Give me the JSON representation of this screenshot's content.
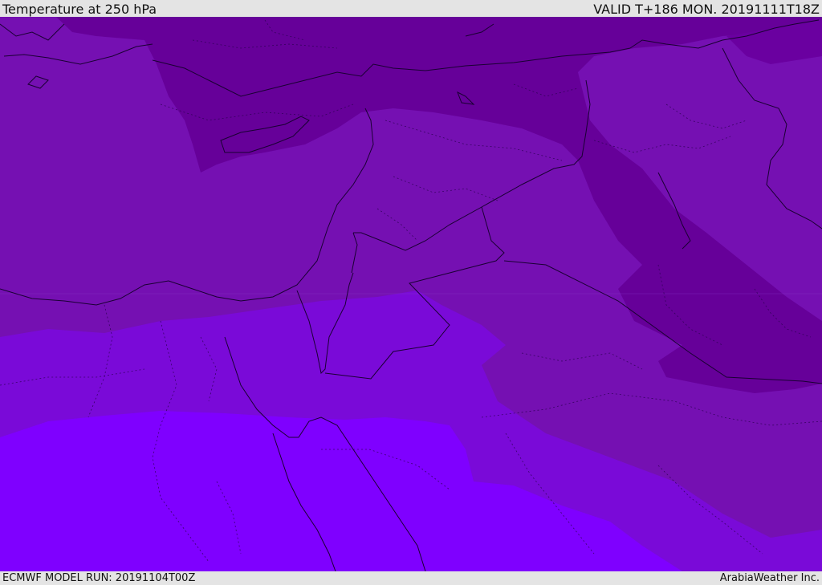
{
  "header": {
    "title": "Temperature at 250 hPa",
    "valid": "VALID T+186 MON. 20191111T18Z"
  },
  "footer": {
    "model_run": "ECMWF MODEL RUN: 20191104T00Z",
    "credit": "ArabiaWeather Inc."
  },
  "map": {
    "variable": "temperature",
    "level": "250 hPa",
    "colors": {
      "darkest": "#660099",
      "dark": "#6e08a2",
      "medium": "#7510b2",
      "bright": "#7d00f2",
      "brightest": "#7f00ff",
      "border": "#1a0033"
    }
  }
}
